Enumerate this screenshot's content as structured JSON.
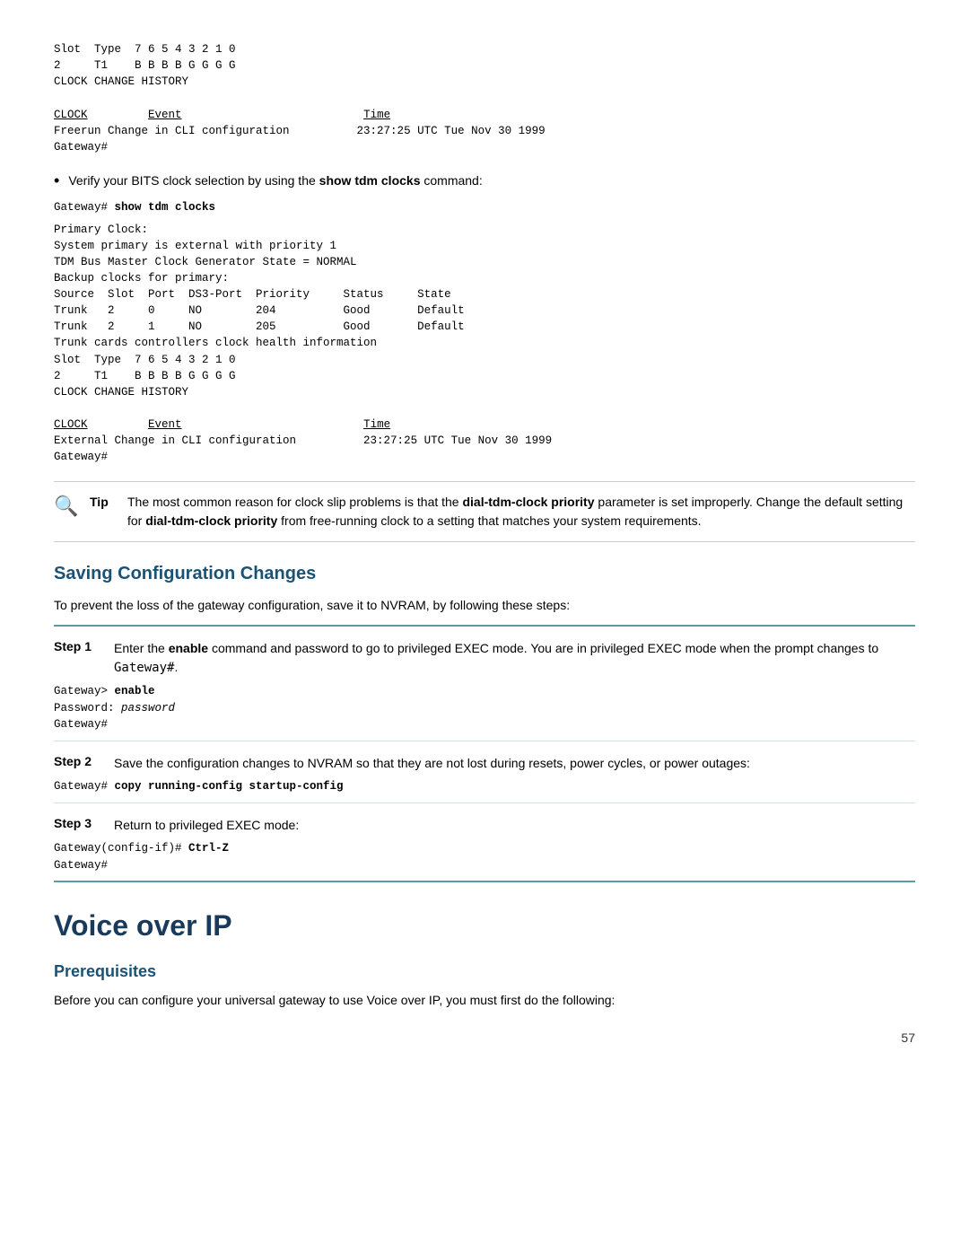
{
  "page": {
    "number": "57"
  },
  "code_block_1": {
    "content": "Slot  Type  7 6 5 4 3 2 1 0\n2     T1    B B B B G G G G\nCLOCK CHANGE HISTORY\n\nCLOCK         Event                           Time\nFreerun Change in CLI configuration          23:27:25 UTC Tue Nov 30 1999\nGateway#"
  },
  "bullet": {
    "text_before": "Verify your BITS clock selection by using the ",
    "bold_text": "show tdm clocks",
    "text_after": " command:"
  },
  "gateway_show_cmd": "Gateway# show tdm clocks",
  "code_block_2": {
    "content": "Primary Clock:\nSystem primary is external with priority 1\nTDM Bus Master Clock Generator State = NORMAL\nBackup clocks for primary:\nSource  Slot  Port  DS3-Port  Priority     Status     State\nTrunk   2     0     NO        204          Good       Default\nTrunk   2     1     NO        205          Good       Default\nTrunk cards controllers clock health information\nSlot  Type  7 6 5 4 3 2 1 0\n2     T1    B B B B G G G G\nCLOCK CHANGE HISTORY\n\nCLOCK         Event                           Time\nExternal Change in CLI configuration          23:27:25 UTC Tue Nov 30 1999\nGateway#"
  },
  "tip": {
    "label": "Tip",
    "text_before": "The most common reason for clock slip problems is that the ",
    "bold1": "dial-tdm-clock priority",
    "text_middle": " parameter is set improperly. Change the default setting for ",
    "bold2": "dial-tdm-clock priority",
    "text_after": " from free-running clock to a setting that matches your system requirements."
  },
  "saving_section": {
    "heading": "Saving Configuration Changes",
    "intro": "To prevent the loss of the gateway configuration, save it to NVRAM, by following these steps:"
  },
  "steps": [
    {
      "label": "Step 1",
      "text_before": "Enter the ",
      "bold": "enable",
      "text_after": " command and password to go to privileged EXEC mode. You are in privileged EXEC mode when the prompt changes to Gateway#.",
      "code": "Gateway> enable\nPassword: password\nGateway#"
    },
    {
      "label": "Step 2",
      "text": "Save the configuration changes to NVRAM so that they are not lost during resets, power cycles, or power outages:",
      "code": "Gateway# copy running-config startup-config"
    },
    {
      "label": "Step 3",
      "text": "Return to privileged EXEC mode:",
      "code": "Gateway(config-if)# Ctrl-Z\nGateway#"
    }
  ],
  "voice_section": {
    "main_heading": "Voice over IP",
    "prereq_heading": "Prerequisites",
    "prereq_text": "Before you can configure your universal gateway to use Voice over IP, you must first do the following:"
  }
}
